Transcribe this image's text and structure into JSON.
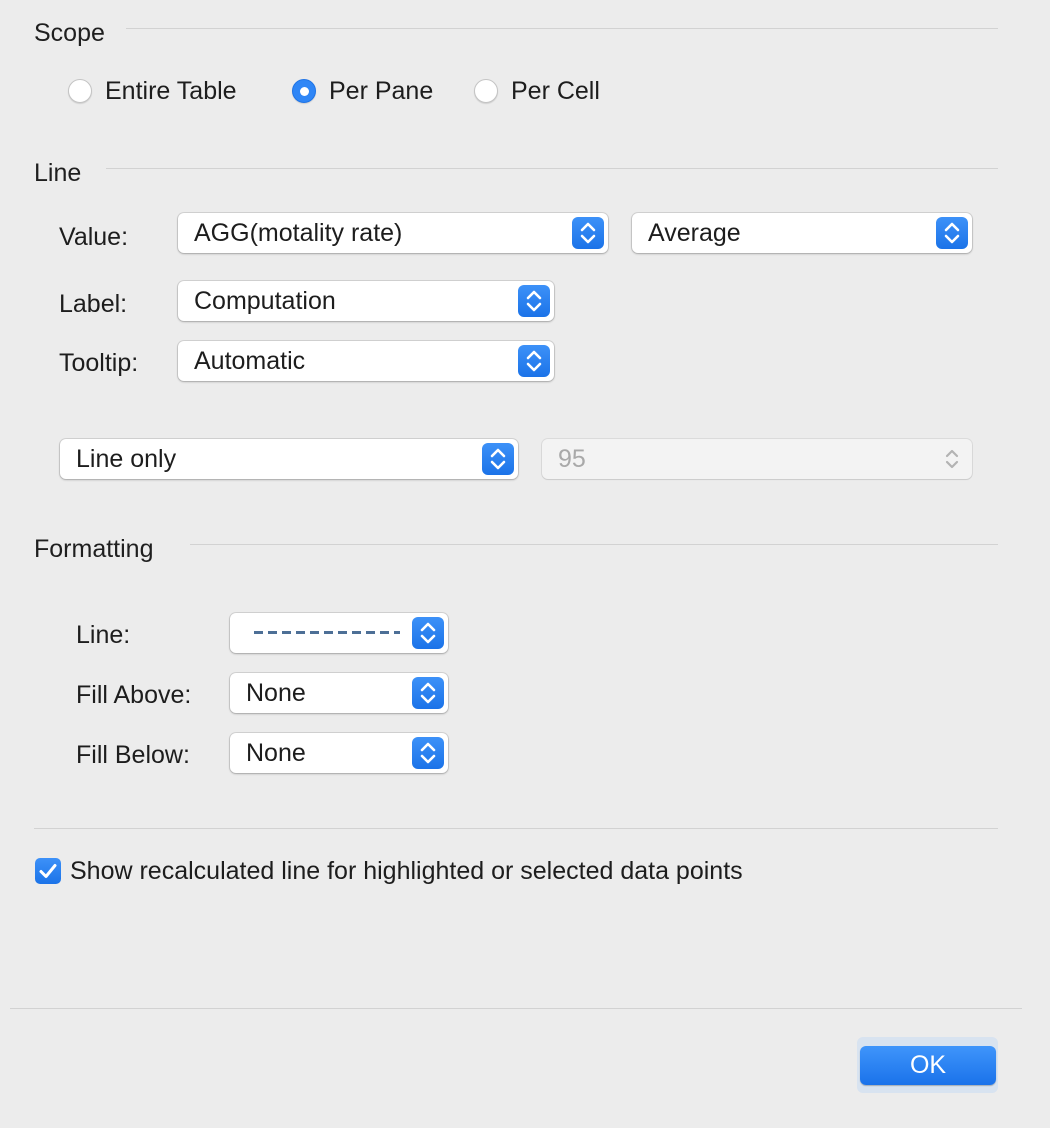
{
  "scope": {
    "title": "Scope",
    "options": [
      {
        "label": "Entire Table",
        "selected": false
      },
      {
        "label": "Per Pane",
        "selected": true
      },
      {
        "label": "Per Cell",
        "selected": false
      }
    ]
  },
  "line": {
    "title": "Line",
    "value_label": "Value:",
    "value_field": "AGG(motality rate)",
    "value_aggregation": "Average",
    "label_label": "Label:",
    "label_value": "Computation",
    "tooltip_label": "Tooltip:",
    "tooltip_value": "Automatic",
    "band_type": "Line only",
    "confidence_value": "95"
  },
  "formatting": {
    "title": "Formatting",
    "line_label": "Line:",
    "line_style": "dashed",
    "line_color": "#4d6f96",
    "fill_above_label": "Fill Above:",
    "fill_above_value": "None",
    "fill_below_label": "Fill Below:",
    "fill_below_value": "None"
  },
  "recalc": {
    "label": "Show recalculated line for highlighted or selected data points",
    "checked": true
  },
  "footer": {
    "ok_label": "OK"
  },
  "colors": {
    "accent": "#2f86f6",
    "background": "#ececec"
  }
}
